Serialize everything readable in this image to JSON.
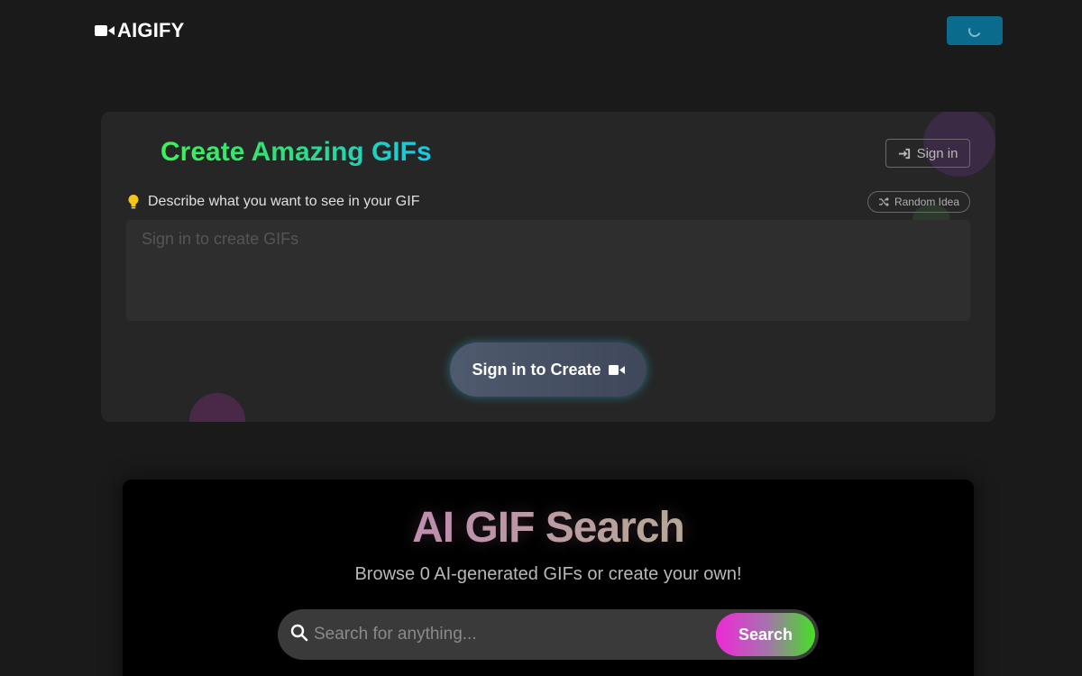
{
  "header": {
    "brand": "AIGIFY",
    "brand_icon": "video-camera-icon",
    "loading_icon": "spinner-icon"
  },
  "create": {
    "title": "Create Amazing GIFs",
    "signin_label": "Sign in",
    "signin_icon": "sign-in-icon",
    "prompt_label": "Describe what you want to see in your GIF",
    "prompt_icon": "lightbulb-icon",
    "random_label": "Random Idea",
    "random_icon": "shuffle-icon",
    "prompt_placeholder": "Sign in to create GIFs",
    "create_label": "Sign in to Create",
    "create_icon": "video-camera-icon"
  },
  "search": {
    "title": "AI GIF Search",
    "subtitle": "Browse 0 AI-generated GIFs or create your own!",
    "placeholder": "Search for anything...",
    "button_label": "Search",
    "icon": "search-icon"
  },
  "colors": {
    "background": "#1a1a1a",
    "card": "#262626",
    "accent_loading": "#0b6b8d"
  }
}
